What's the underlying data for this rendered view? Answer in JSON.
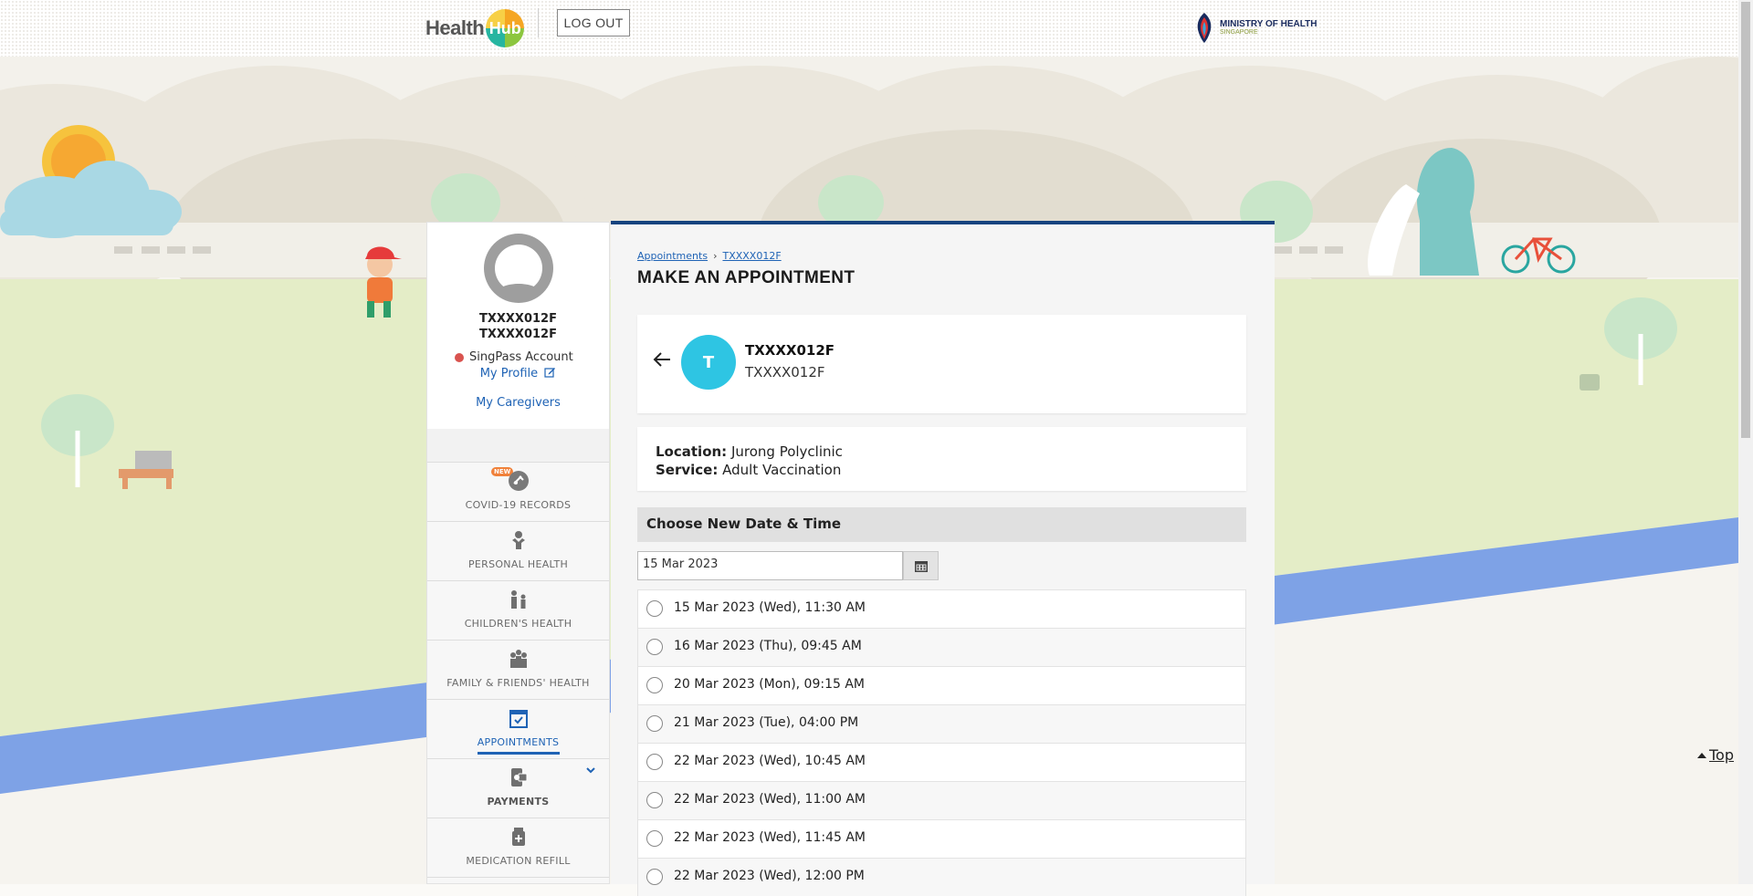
{
  "header": {
    "logo_text": "Health",
    "logo_hub": "Hub",
    "logout_label": "LOG OUT",
    "moh_line1": "MINISTRY OF HEALTH",
    "moh_line2": "SINGAPORE"
  },
  "profile": {
    "name": "TXXXX012F",
    "id": "TXXXX012F",
    "account_type": "SingPass Account",
    "my_profile": "My Profile",
    "my_caregivers": "My Caregivers"
  },
  "sidebar": {
    "new_badge": "NEW",
    "items": [
      {
        "label": "COVID-19 RECORDS",
        "icon": "covid-records-icon"
      },
      {
        "label": "PERSONAL HEALTH",
        "icon": "person-icon"
      },
      {
        "label": "CHILDREN'S HEALTH",
        "icon": "children-icon"
      },
      {
        "label": "FAMILY & FRIENDS' HEALTH",
        "icon": "family-icon"
      },
      {
        "label": "APPOINTMENTS",
        "icon": "calendar-check-icon"
      },
      {
        "label": "PAYMENTS",
        "icon": "payments-icon"
      },
      {
        "label": "MEDICATION REFILL",
        "icon": "medication-icon"
      }
    ]
  },
  "main": {
    "breadcrumb": [
      "Appointments",
      "TXXXX012F"
    ],
    "title": "MAKE AN APPOINTMENT",
    "patient": {
      "initial": "T",
      "name": "TXXXX012F",
      "id": "TXXXX012F"
    },
    "location_label": "Location:",
    "location": "Jurong Polyclinic",
    "service_label": "Service:",
    "service": "Adult Vaccination",
    "section_title": "Choose New Date & Time",
    "date_value": "15 Mar 2023",
    "slots": [
      "15 Mar 2023 (Wed), 11:30 AM",
      "16 Mar 2023 (Thu), 09:45 AM",
      "20 Mar 2023 (Mon), 09:15 AM",
      "21 Mar 2023 (Tue), 04:00 PM",
      "22 Mar 2023 (Wed), 10:45 AM",
      "22 Mar 2023 (Wed), 11:00 AM",
      "22 Mar 2023 (Wed), 11:45 AM",
      "22 Mar 2023 (Wed), 12:00 PM"
    ]
  },
  "top_link": "Top",
  "colors": {
    "accent": "#1f63b5",
    "panel_border": "#15437e",
    "avatar_circle": "#2ec5e3",
    "status_dot": "#d9534f"
  }
}
